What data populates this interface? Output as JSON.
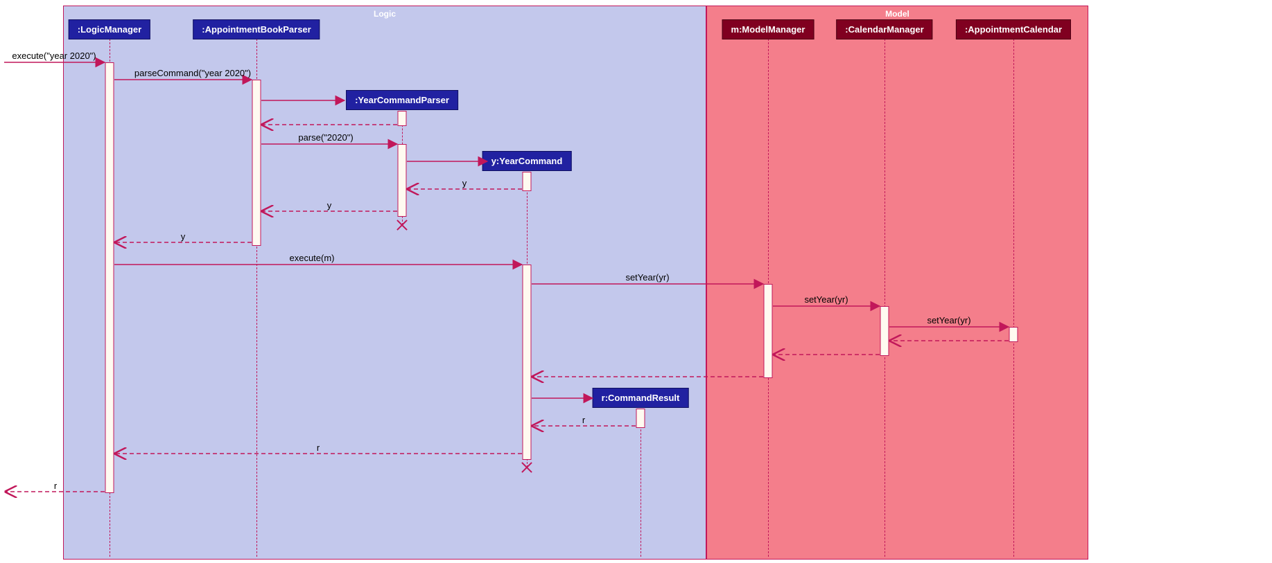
{
  "diagram": {
    "frames": {
      "logic": {
        "title": "Logic"
      },
      "model": {
        "title": "Model"
      }
    },
    "participants": {
      "logic_manager": {
        "label": ":LogicManager"
      },
      "appt_book_parser": {
        "label": ":AppointmentBookParser"
      },
      "year_cmd_parser": {
        "label": ":YearCommandParser"
      },
      "year_command": {
        "label": "y:YearCommand"
      },
      "command_result": {
        "label": "r:CommandResult"
      },
      "model_manager": {
        "label": "m:ModelManager"
      },
      "calendar_manager": {
        "label": ":CalendarManager"
      },
      "appointment_calendar": {
        "label": ":AppointmentCalendar"
      }
    },
    "messages": {
      "m1": {
        "text": "execute(\"year 2020\")"
      },
      "m2": {
        "text": "parseCommand(\"year 2020\")"
      },
      "m3": {
        "text": ""
      },
      "m4": {
        "text": "parse(\"2020\")"
      },
      "m5": {
        "text": ""
      },
      "m6": {
        "text": "y"
      },
      "m7": {
        "text": "y"
      },
      "m8": {
        "text": "y"
      },
      "m9": {
        "text": "execute(m)"
      },
      "m10": {
        "text": "setYear(yr)"
      },
      "m11": {
        "text": "setYear(yr)"
      },
      "m12": {
        "text": "setYear(yr)"
      },
      "m13": {
        "text": ""
      },
      "m14": {
        "text": ""
      },
      "m15": {
        "text": ""
      },
      "m16": {
        "text": "r"
      },
      "m17": {
        "text": "r"
      },
      "m18": {
        "text": "r"
      }
    }
  },
  "chart_data": {
    "type": "sequence-diagram",
    "frames": [
      {
        "name": "Logic",
        "participants": [
          ":LogicManager",
          ":AppointmentBookParser",
          ":YearCommandParser",
          "y:YearCommand",
          "r:CommandResult"
        ]
      },
      {
        "name": "Model",
        "participants": [
          "m:ModelManager",
          ":CalendarManager",
          ":AppointmentCalendar"
        ]
      }
    ],
    "participants": [
      ":LogicManager",
      ":AppointmentBookParser",
      ":YearCommandParser",
      "y:YearCommand",
      "r:CommandResult",
      "m:ModelManager",
      ":CalendarManager",
      ":AppointmentCalendar"
    ],
    "messages": [
      {
        "from": "(external)",
        "to": ":LogicManager",
        "label": "execute(\"year 2020\")",
        "type": "sync"
      },
      {
        "from": ":LogicManager",
        "to": ":AppointmentBookParser",
        "label": "parseCommand(\"year 2020\")",
        "type": "sync"
      },
      {
        "from": ":AppointmentBookParser",
        "to": ":YearCommandParser",
        "label": "",
        "type": "create"
      },
      {
        "from": ":YearCommandParser",
        "to": ":AppointmentBookParser",
        "label": "",
        "type": "return"
      },
      {
        "from": ":AppointmentBookParser",
        "to": ":YearCommandParser",
        "label": "parse(\"2020\")",
        "type": "sync"
      },
      {
        "from": ":YearCommandParser",
        "to": "y:YearCommand",
        "label": "",
        "type": "create"
      },
      {
        "from": "y:YearCommand",
        "to": ":YearCommandParser",
        "label": "y",
        "type": "return"
      },
      {
        "from": ":YearCommandParser",
        "to": ":AppointmentBookParser",
        "label": "y",
        "type": "return"
      },
      {
        "from": ":AppointmentBookParser",
        "to": ":LogicManager",
        "label": "y",
        "type": "return"
      },
      {
        "from": ":LogicManager",
        "to": "y:YearCommand",
        "label": "execute(m)",
        "type": "sync"
      },
      {
        "from": "y:YearCommand",
        "to": "m:ModelManager",
        "label": "setYear(yr)",
        "type": "sync"
      },
      {
        "from": "m:ModelManager",
        "to": ":CalendarManager",
        "label": "setYear(yr)",
        "type": "sync"
      },
      {
        "from": ":CalendarManager",
        "to": ":AppointmentCalendar",
        "label": "setYear(yr)",
        "type": "sync"
      },
      {
        "from": ":AppointmentCalendar",
        "to": ":CalendarManager",
        "label": "",
        "type": "return"
      },
      {
        "from": ":CalendarManager",
        "to": "m:ModelManager",
        "label": "",
        "type": "return"
      },
      {
        "from": "m:ModelManager",
        "to": "y:YearCommand",
        "label": "",
        "type": "return"
      },
      {
        "from": "y:YearCommand",
        "to": "r:CommandResult",
        "label": "",
        "type": "create"
      },
      {
        "from": "r:CommandResult",
        "to": "y:YearCommand",
        "label": "r",
        "type": "return"
      },
      {
        "from": "y:YearCommand",
        "to": ":LogicManager",
        "label": "r",
        "type": "return"
      },
      {
        "from": ":LogicManager",
        "to": "(external)",
        "label": "r",
        "type": "return"
      }
    ],
    "destroyed": [
      ":YearCommandParser",
      "y:YearCommand"
    ]
  }
}
